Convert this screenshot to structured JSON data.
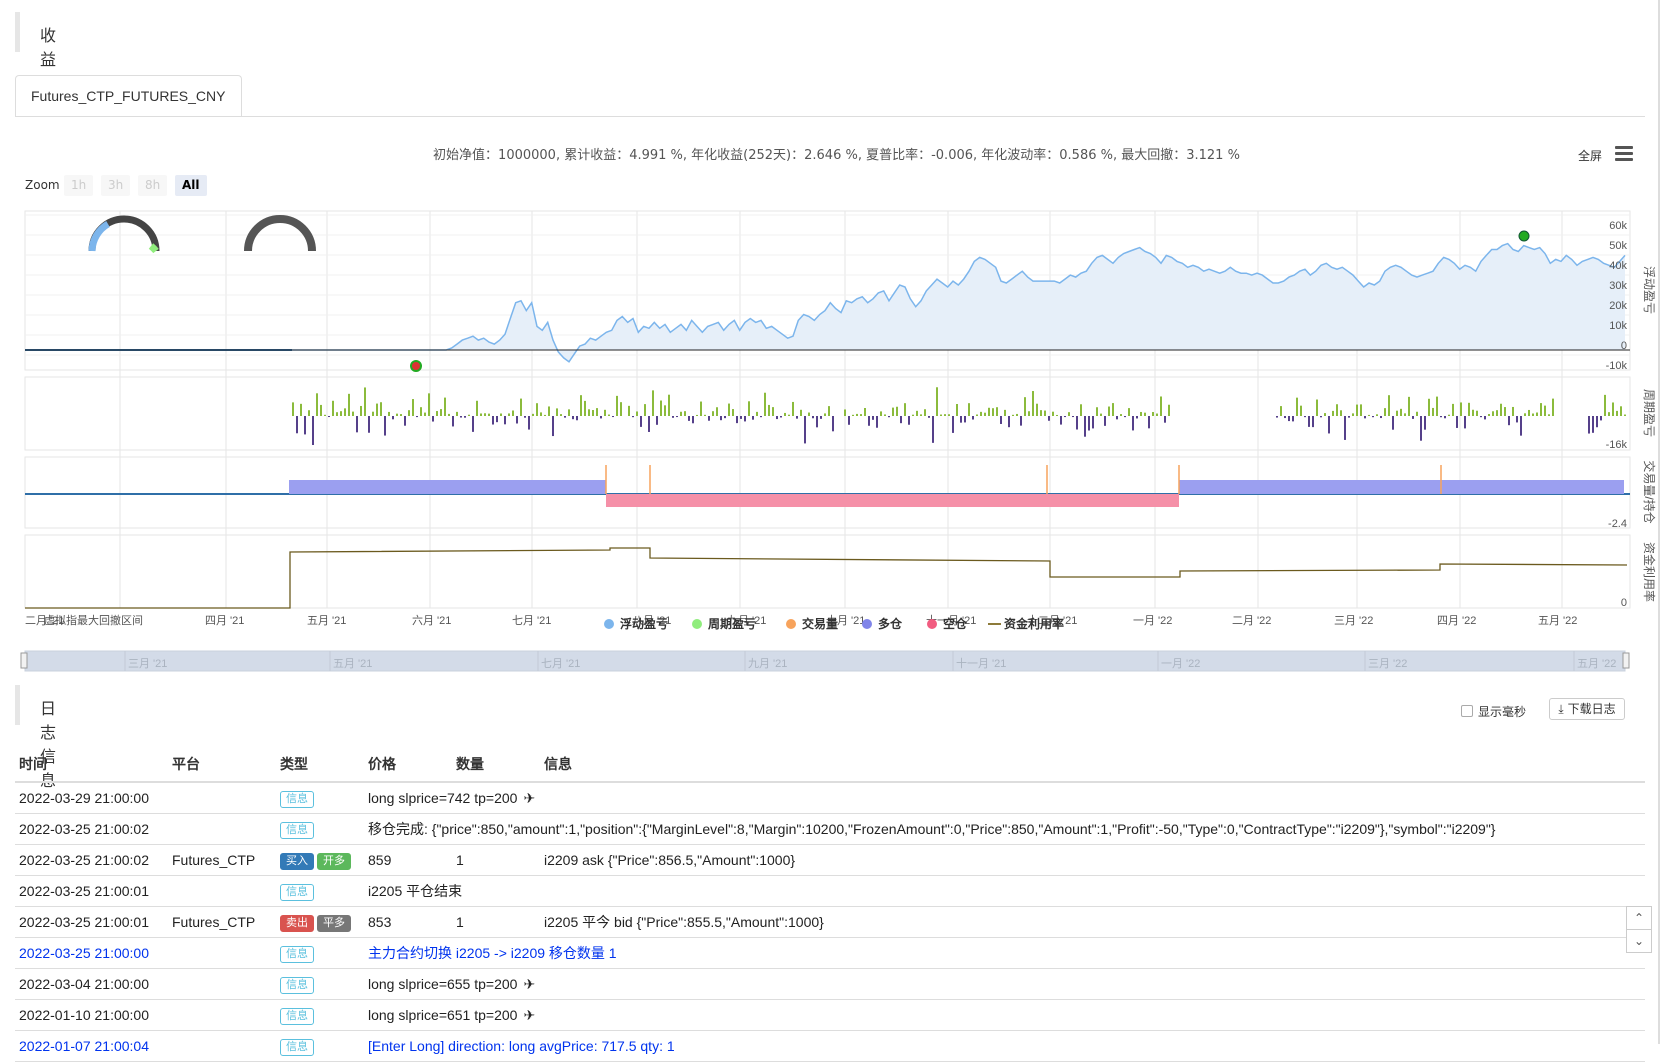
{
  "overview": {
    "title": "收益概览",
    "tab": "Futures_CTP_FUTURES_CNY"
  },
  "summary_text": "初始净值：1000000, 累计收益：4.991 %, 年化收益(252天)：2.646 %, 夏普比率：-0.006, 年化波动率：0.586 %, 最大回撤：3.121 %",
  "toolbar": {
    "fullscreen": "全屏",
    "zoom_label": "Zoom",
    "zoom_buttons": [
      "1h",
      "3h",
      "8h",
      "All"
    ],
    "zoom_active": "All"
  },
  "chart_data": {
    "type": "line",
    "panes": [
      {
        "name": "浮动盈亏",
        "y_ticks": [
          "60k",
          "50k",
          "40k",
          "30k",
          "20k",
          "10k",
          "0",
          "-10k"
        ],
        "values_k": [
          0,
          0,
          0,
          0,
          0,
          0,
          0,
          0,
          0,
          0,
          0,
          0,
          0,
          0,
          0,
          0,
          0,
          0,
          0,
          0,
          0,
          0,
          0,
          0,
          0,
          0,
          0,
          0,
          0,
          0,
          0,
          0,
          0,
          0,
          0,
          0,
          0,
          0,
          0,
          0,
          0,
          0,
          0,
          0,
          0,
          0,
          0,
          0,
          0,
          0,
          0,
          0,
          0,
          0,
          0,
          0,
          0,
          0,
          0,
          0,
          0,
          0,
          0,
          0,
          0,
          0,
          0,
          0,
          0,
          0,
          0,
          0,
          0,
          0,
          0,
          0,
          0,
          0,
          0,
          0,
          1,
          3,
          5,
          6,
          7,
          5,
          6,
          4,
          3,
          5,
          8,
          16,
          24,
          25,
          20,
          24,
          12,
          10,
          14,
          5,
          -1,
          -4,
          -6,
          -2,
          2,
          3,
          6,
          5,
          7,
          9,
          10,
          15,
          17,
          14,
          16,
          9,
          12,
          11,
          14,
          11,
          13,
          9,
          11,
          13,
          10,
          15,
          12,
          9,
          12,
          13,
          14,
          10,
          13,
          15,
          10,
          14,
          16,
          14,
          15,
          11,
          12,
          10,
          8,
          6,
          7,
          15,
          18,
          17,
          15,
          18,
          20,
          24,
          21,
          19,
          25,
          24,
          26,
          27,
          24,
          26,
          29,
          30,
          25,
          29,
          33,
          32,
          26,
          22,
          25,
          30,
          33,
          36,
          34,
          32,
          35,
          33,
          36,
          40,
          45,
          47,
          46,
          44,
          42,
          35,
          34,
          36,
          38,
          40,
          37,
          35,
          35,
          35,
          35,
          35,
          34,
          36,
          38,
          37,
          39,
          40,
          44,
          47,
          48,
          46,
          44,
          47,
          49,
          50,
          51,
          52,
          50,
          49,
          47,
          44,
          48,
          47,
          45,
          44,
          42,
          43,
          42,
          40,
          41,
          40,
          39,
          40,
          42,
          40,
          39,
          39,
          38,
          39,
          38,
          36,
          34,
          34,
          35,
          37,
          38,
          40,
          41,
          38,
          40,
          43,
          44,
          42,
          41,
          42,
          40,
          38,
          35,
          32,
          34,
          33,
          35,
          40,
          42,
          43,
          42,
          40,
          38,
          37,
          38,
          39,
          40,
          44,
          47,
          46,
          44,
          41,
          43,
          42,
          40,
          45,
          48,
          51,
          51,
          53,
          54,
          51,
          50,
          53,
          52,
          51,
          52,
          49,
          44,
          46,
          45,
          48,
          46,
          43,
          45,
          46,
          47,
          46,
          44,
          43,
          42,
          45,
          48
        ]
      },
      {
        "name": "周期盈亏",
        "y_ticks": [
          "-16k"
        ]
      },
      {
        "name": "交易量/持仓",
        "y_ticks": [
          "-2.4"
        ]
      },
      {
        "name": "资金利用率",
        "y_ticks": [
          "0"
        ]
      }
    ],
    "x_ticks": [
      "二月 '21",
      "四月 '21",
      "五月 '21",
      "六月 '21",
      "七月 '21",
      "八月 '21",
      "九月 '21",
      "十月 '21",
      "十一月 '21",
      "十二月 '21",
      "一月 '22",
      "二月 '22",
      "三月 '22",
      "四月 '22",
      "五月 '22"
    ],
    "x_overlay_text": "虚拟指最大回撤区间",
    "navigator_ticks": [
      "三月 '21",
      "五月 '21",
      "七月 '21",
      "九月 '21",
      "十一月 '21",
      "一月 '22",
      "三月 '22",
      "五月 '22"
    ],
    "legend": [
      {
        "name": "浮动盈亏",
        "color": "#7cb5ec"
      },
      {
        "name": "周期盈亏",
        "color": "#90ed7d"
      },
      {
        "name": "交易量",
        "color": "#f7a35c"
      },
      {
        "name": "多仓",
        "color": "#8085e9"
      },
      {
        "name": "空仓",
        "color": "#f15c80"
      },
      {
        "name": "资金利用率",
        "color": "#8d7b3a"
      }
    ],
    "colors": {
      "line": "#7cb5ec",
      "area": "#e6eff9",
      "long": "#9b9ff0",
      "short": "#f590a8",
      "volume": "#f7a35c",
      "utilization": "#6b5a1e"
    }
  },
  "log": {
    "title": "日志信息",
    "show_ms": "显示毫秒",
    "download": "下载日志",
    "columns": [
      "时间",
      "平台",
      "类型",
      "价格",
      "数量",
      "信息"
    ],
    "rows": [
      {
        "time": "2022-03-29 21:00:00",
        "platform": "",
        "badges": [
          [
            "信息",
            "info"
          ]
        ],
        "price": "",
        "amount": "",
        "info": "long slprice=742 tp=200",
        "plane": true,
        "blue": false,
        "span": true
      },
      {
        "time": "2022-03-25 21:00:02",
        "platform": "",
        "badges": [
          [
            "信息",
            "info"
          ]
        ],
        "price": "",
        "amount": "",
        "info": "移仓完成: {\"price\":850,\"amount\":1,\"position\":{\"MarginLevel\":8,\"Margin\":10200,\"FrozenAmount\":0,\"Price\":850,\"Amount\":1,\"Profit\":-50,\"Type\":0,\"ContractType\":\"i2209\"},\"symbol\":\"i2209\"}",
        "plane": false,
        "blue": false,
        "span": true
      },
      {
        "time": "2022-03-25 21:00:02",
        "platform": "Futures_CTP",
        "badges": [
          [
            "买入",
            "buy"
          ],
          [
            "开多",
            "open"
          ]
        ],
        "price": "859",
        "amount": "1",
        "info": "i2209 ask {\"Price\":856.5,\"Amount\":1000}",
        "plane": false,
        "blue": false,
        "span": false
      },
      {
        "time": "2022-03-25 21:00:01",
        "platform": "",
        "badges": [
          [
            "信息",
            "info"
          ]
        ],
        "price": "",
        "amount": "",
        "info": "i2205 平仓结束",
        "plane": false,
        "blue": false,
        "span": true
      },
      {
        "time": "2022-03-25 21:00:01",
        "platform": "Futures_CTP",
        "badges": [
          [
            "卖出",
            "sell"
          ],
          [
            "平多",
            "close"
          ]
        ],
        "price": "853",
        "amount": "1",
        "info": "i2205 平今 bid {\"Price\":855.5,\"Amount\":1000}",
        "plane": false,
        "blue": false,
        "span": false
      },
      {
        "time": "2022-03-25 21:00:00",
        "platform": "",
        "badges": [
          [
            "信息",
            "info"
          ]
        ],
        "price": "",
        "amount": "",
        "info": "主力合约切换 i2205 -> i2209 移仓数量 1",
        "plane": false,
        "blue": true,
        "span": true
      },
      {
        "time": "2022-03-04 21:00:00",
        "platform": "",
        "badges": [
          [
            "信息",
            "info"
          ]
        ],
        "price": "",
        "amount": "",
        "info": "long slprice=655 tp=200",
        "plane": true,
        "blue": false,
        "span": true
      },
      {
        "time": "2022-01-10 21:00:00",
        "platform": "",
        "badges": [
          [
            "信息",
            "info"
          ]
        ],
        "price": "",
        "amount": "",
        "info": "long slprice=651 tp=200",
        "plane": true,
        "blue": false,
        "span": true
      },
      {
        "time": "2022-01-07 21:00:04",
        "platform": "",
        "badges": [
          [
            "信息",
            "info"
          ]
        ],
        "price": "",
        "amount": "",
        "info": "[Enter Long] direction: long avgPrice: 717.5 qty: 1",
        "plane": false,
        "blue": true,
        "span": true
      }
    ]
  }
}
